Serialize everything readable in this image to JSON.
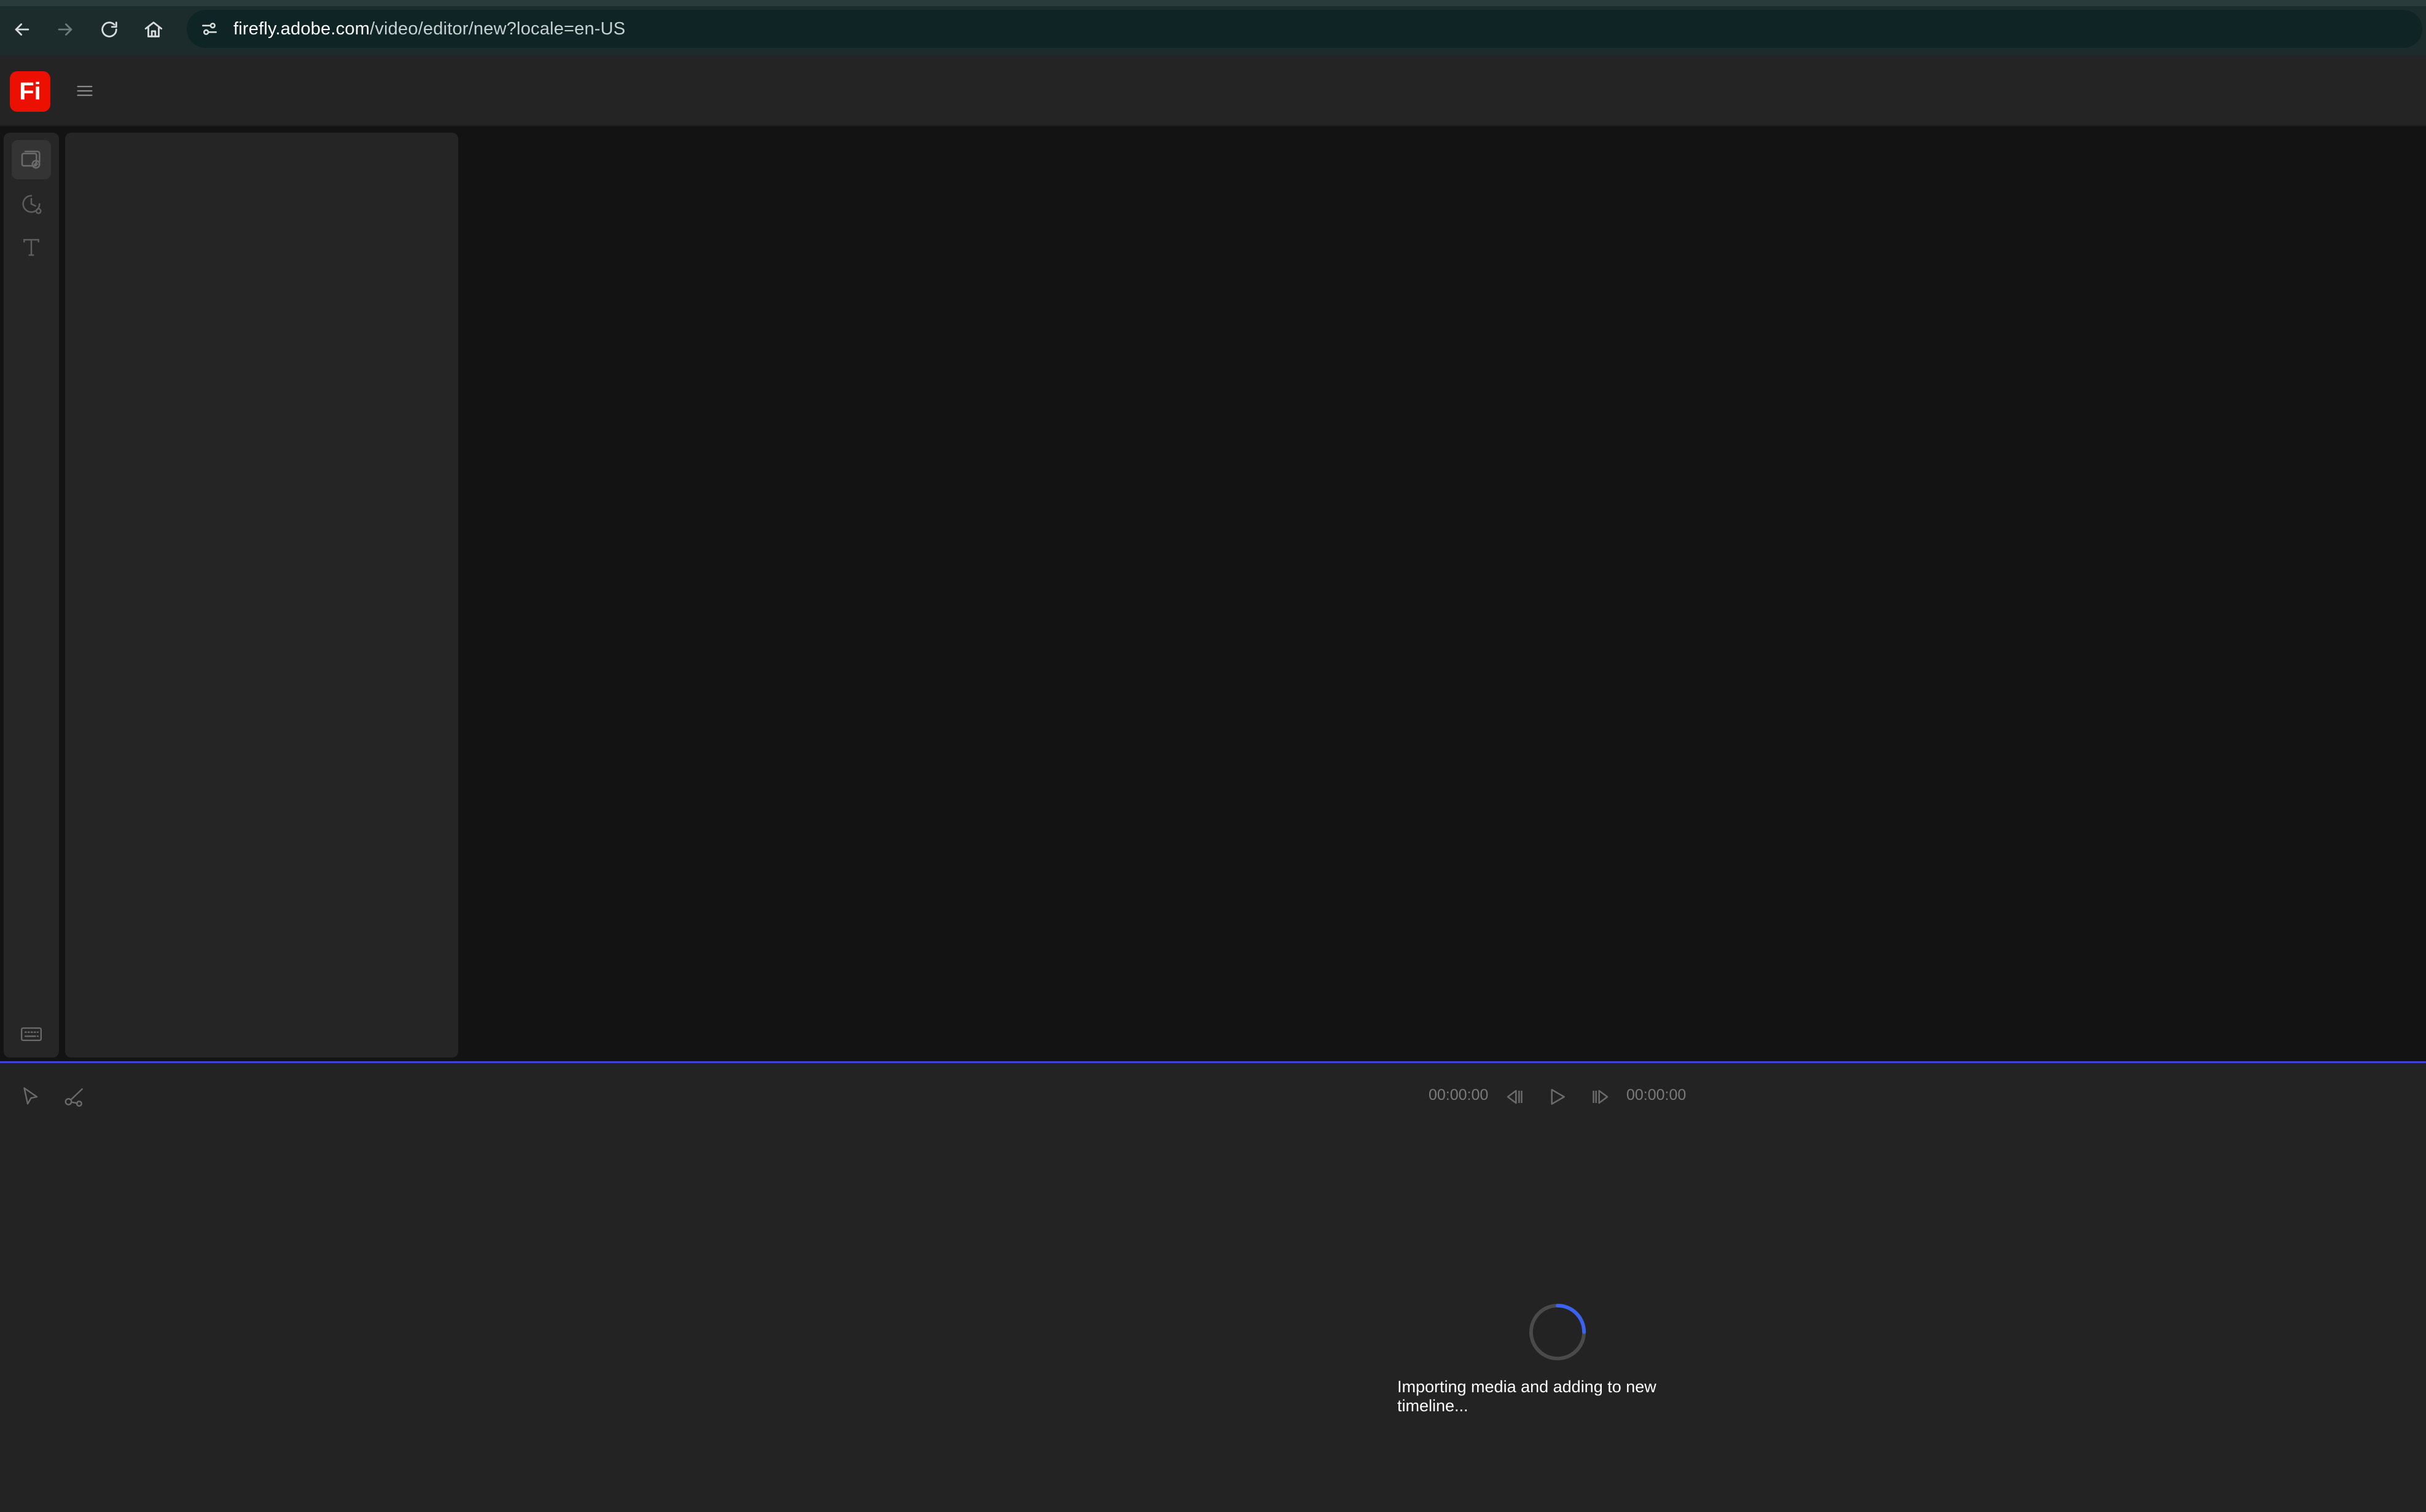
{
  "browser": {
    "url_host": "firefly.adobe.com",
    "url_path": "/video/editor/new?locale=en-US"
  },
  "app": {
    "logo_text": "Fi",
    "brand_color": "#eb1000"
  },
  "left_rail": {
    "items": [
      {
        "icon": "media-icon",
        "active": true
      },
      {
        "icon": "recent-icon",
        "active": false
      },
      {
        "icon": "text-icon",
        "active": false
      }
    ],
    "bottom_icon": "keyboard-icon"
  },
  "timeline": {
    "tools": [
      "select-icon",
      "razor-icon"
    ],
    "current_time": "00:00:00",
    "total_time": "00:00:00",
    "accent_color": "#3b46d6"
  },
  "status": {
    "loading_message": "Importing media and adding to new timeline..."
  }
}
